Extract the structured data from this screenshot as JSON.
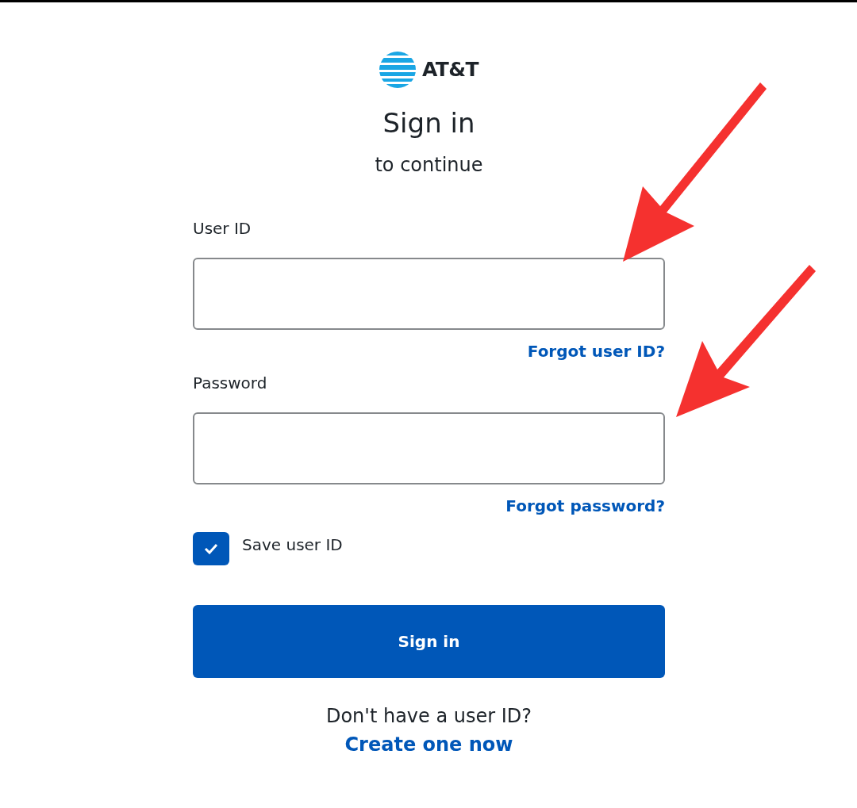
{
  "logo": {
    "text": "AT&T"
  },
  "heading": "Sign in",
  "subheading": "to continue",
  "fields": [
    {
      "label": "User ID",
      "link": "Forgot user ID?"
    },
    {
      "label": "Password",
      "link": "Forgot password?"
    }
  ],
  "save_user_id": {
    "label": "Save user ID",
    "checked": true
  },
  "submit": "Sign in",
  "signup": {
    "prompt": "Don't have a user ID?",
    "link": "Create one now"
  }
}
